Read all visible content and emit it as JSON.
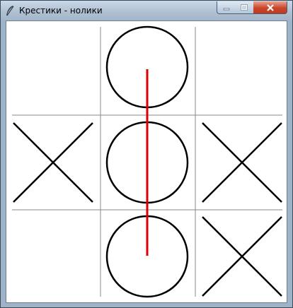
{
  "window": {
    "title": "Крестики - нолики",
    "icon": "feather-icon",
    "buttons": [
      "minimize-icon",
      "maximize-icon",
      "close-icon"
    ]
  },
  "board": {
    "cells": [
      [
        "",
        "O",
        ""
      ],
      [
        "X",
        "O",
        "X"
      ],
      [
        "",
        "O",
        "X"
      ]
    ],
    "winning_line": {
      "column": 2,
      "direction": "vertical"
    },
    "colors": {
      "grid": "#888888",
      "marks": "#000000",
      "win_line": "#dd0000"
    }
  }
}
